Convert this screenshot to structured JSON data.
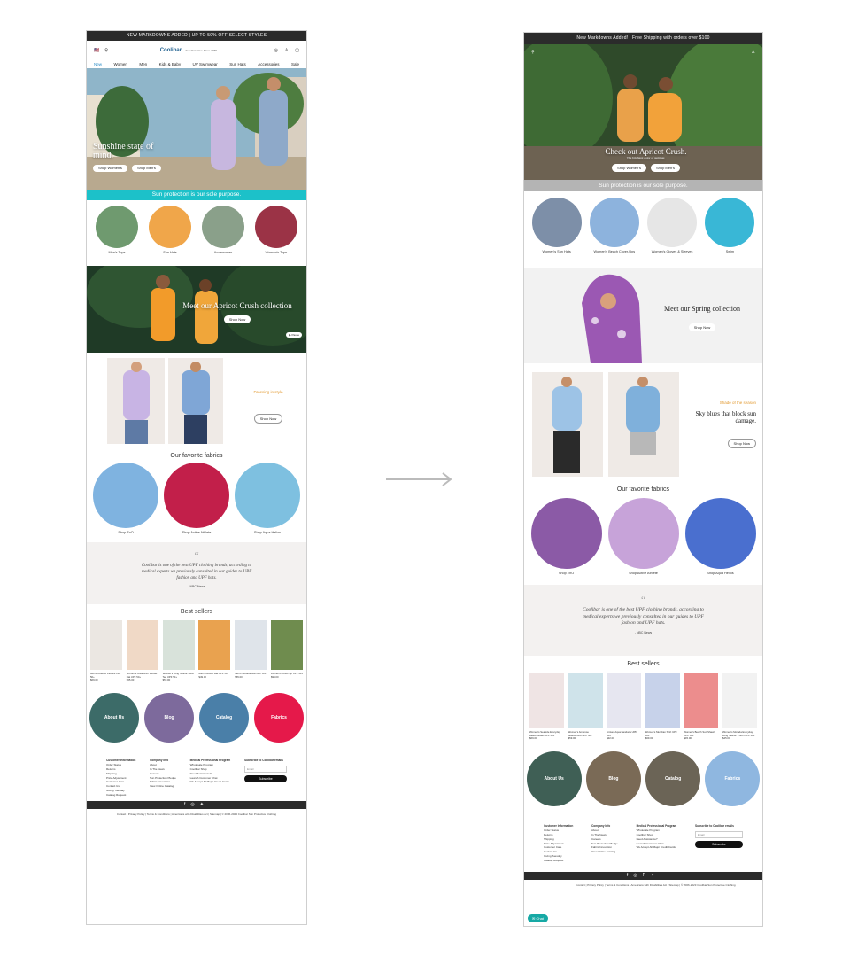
{
  "left": {
    "promo": "NEW MARKDOWNS ADDED | UP TO 50% OFF SELECT STYLES",
    "logo": "Coolibar",
    "logo_sub": "Sun Protective Since 1988",
    "categories": [
      "New",
      "Women",
      "Men",
      "Kids & Baby",
      "UV Swimwear",
      "Sun Hats",
      "Accessories",
      "Sale"
    ],
    "hero": {
      "headline": "Sunshine state of mind.",
      "btn1": "Shop Women's",
      "btn2": "Shop Men's"
    },
    "band": "Sun protection is our sole purpose.",
    "circles": [
      "Men's Tops",
      "Sun Hats",
      "Accessories",
      "Women's Tops"
    ],
    "collection": {
      "headline": "Meet our Apricot Crush collection",
      "btn": "Shop Now"
    },
    "promo2": {
      "text": "Dressing in style",
      "btn": "Shop Now"
    },
    "fabrics_title": "Our favorite fabrics",
    "fabrics": [
      "Shop ZnO",
      "Shop Active Athlete",
      "Shop Aqua Helios"
    ],
    "quote": {
      "text": "Coolibar is one of the best UPF clothing brands, according to medical experts we previously consulted in our guides to UPF fashion and UPF hats.",
      "source": "- NBC News"
    },
    "bestsellers_title": "Best sellers",
    "products": [
      {
        "name": "Men's Outdoor Fedora UPF 50+",
        "price": "$69.00"
      },
      {
        "name": "Women's Wide Brim Bucket Hat UPF 50+",
        "price": "$55.00"
      },
      {
        "name": "Women's Long Sleeve Swim Tee UPF 50+",
        "price": "$59.00"
      },
      {
        "name": "Men's Bucket Hat UPF 50+",
        "price": "$49.00"
      },
      {
        "name": "Men's Outdoor Hat UPF 50+",
        "price": "$65.00"
      },
      {
        "name": "Women's Cover Up UPF 50+",
        "price": "$99.00"
      }
    ],
    "big_circles": [
      "About Us",
      "Blog",
      "Catalog",
      "Fabrics"
    ],
    "footer": {
      "col1_title": "Customer Information",
      "col1": [
        "Order Status",
        "Returns",
        "Shipping",
        "Price Adjustment",
        "Customer Care",
        "Contact Us",
        "Giving Tuesday",
        "Catalog Request"
      ],
      "col2_title": "Company Info",
      "col2": [
        "About",
        "In The News",
        "Careers",
        "Sun Protection Pledge",
        "Fabric Innovation",
        "View Online Catalog"
      ],
      "col3_title": "Medical Professional Program",
      "col3": [
        "Wholesale Program",
        "Coolibar Shop",
        "Need Assistance?",
        "Launch Customer Chat",
        "We Accept All Major Credit Cards"
      ],
      "col4_title": "Subscribe to Coolibar emails",
      "email_placeholder": "Email",
      "subscribe": "Subscribe"
    },
    "legal": "Contact | Privacy Policy | Terms & Conditions | Americans with Disabilities Act | Sitemap | © 2006-2023 Coolibar Sun Protective Clothing"
  },
  "right": {
    "promo": "New Markdowns Added! | Free Shipping with orders over $100",
    "hero": {
      "headline": "Check out Apricot Crush.",
      "sub": "The brightest color of summer.",
      "btn1": "Shop Women's",
      "btn2": "Shop Men's"
    },
    "band": "Sun protection is our sole purpose.",
    "circles": [
      "Women's Sun Hats",
      "Women's Beach Cover-Ups",
      "Women's Gloves & Sleeves",
      "Swim"
    ],
    "spring": {
      "headline": "Meet our Spring collection",
      "btn": "Shop Now"
    },
    "promo2": {
      "kicker": "Shade of the season",
      "text": "Sky blues that block sun damage.",
      "btn": "Shop Now"
    },
    "fabrics_title": "Our favorite fabrics",
    "fabrics": [
      "Shop ZnO",
      "Shop Active Athlete",
      "Shop Aqua Helios"
    ],
    "quote": {
      "text": "Coolibar is one of the best UPF clothing brands, according to medical experts we previously consulted in our guides to UPF fashion and UPF hats.",
      "source": "- NBC News"
    },
    "bestsellers_title": "Best sellers",
    "products": [
      {
        "name": "Women's Seaside Everyday Beach Shawl UPF 50+",
        "price": "$69.00"
      },
      {
        "name": "Women's Ambrose Boardshorts UPF 50+",
        "price": "$59.00"
      },
      {
        "name": "Unisex Aqua Bandana UPF 50+",
        "price": "$32.00"
      },
      {
        "name": "Women's Meridian Shirt UPF 50+",
        "price": "$69.00"
      },
      {
        "name": "Women's Beach Sun Shawl UPF 50+",
        "price": "$45.00"
      },
      {
        "name": "Women's Morada Everyday Long Sleeve T-Shirt UPF 50+",
        "price": "$45.00"
      }
    ],
    "big_circles": [
      "About Us",
      "Blog",
      "Catalog",
      "Fabrics"
    ],
    "chat": "Chat",
    "legal": "Contact | Privacy Policy | Terms & Conditions | Americans with Disabilities Act | Sitemap | © 2006-2023 Coolibar Sun Protective Clothing"
  }
}
